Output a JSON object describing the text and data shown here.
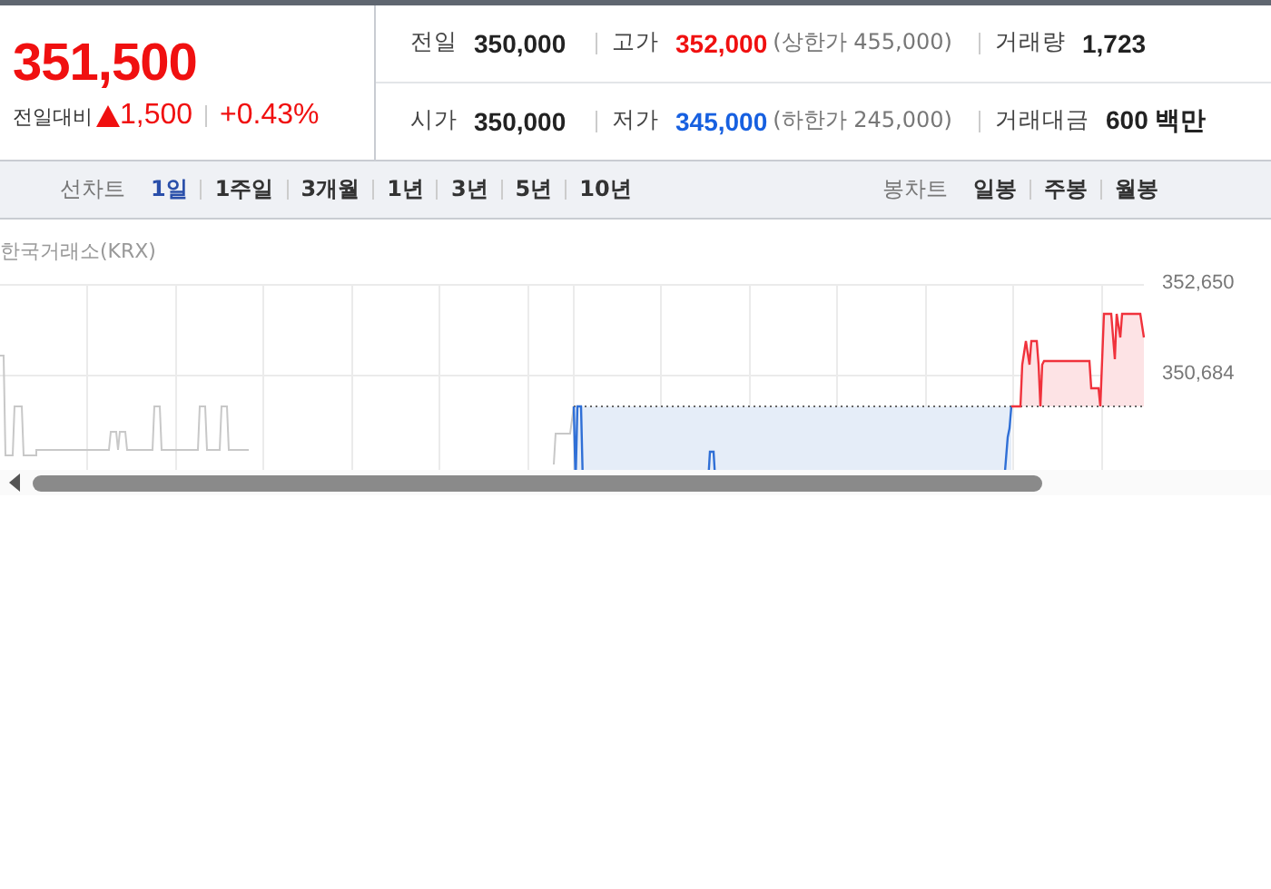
{
  "quote": {
    "price": "351,500",
    "change_label": "전일대비",
    "rising": true,
    "change": "1,500",
    "change_rate": "+0.43%"
  },
  "stats": [
    {
      "label": "전일",
      "value": "350,000",
      "color": "#222222"
    },
    {
      "label": "고가",
      "value": "352,000",
      "color": "#f01010",
      "note": "(상한가 455,000)"
    },
    {
      "label": "거래량",
      "value": "1,723",
      "color": "#222222"
    },
    {
      "label": "시가",
      "value": "350,000",
      "color": "#222222"
    },
    {
      "label": "저가",
      "value": "345,000",
      "color": "#1760e0",
      "note": "(하한가 245,000)"
    },
    {
      "label": "거래대금",
      "value": "600 백만",
      "color": "#222222"
    }
  ],
  "chart_tabs": [
    {
      "label": "선차트",
      "items": [
        {
          "label": "1일",
          "selected": true
        },
        {
          "label": "1주일",
          "selected": false
        },
        {
          "label": "3개월",
          "selected": false
        },
        {
          "label": "1년",
          "selected": false
        },
        {
          "label": "3년",
          "selected": false
        },
        {
          "label": "5년",
          "selected": false
        },
        {
          "label": "10년",
          "selected": false
        }
      ]
    },
    {
      "label": "봉차트",
      "items": [
        {
          "label": "일봉",
          "selected": false
        },
        {
          "label": "주봉",
          "selected": false
        },
        {
          "label": "월봉",
          "selected": false
        }
      ]
    }
  ],
  "chart": {
    "source": "한국거래소(KRX)",
    "y_labels": [
      "352,650",
      "350,684"
    ]
  }
}
